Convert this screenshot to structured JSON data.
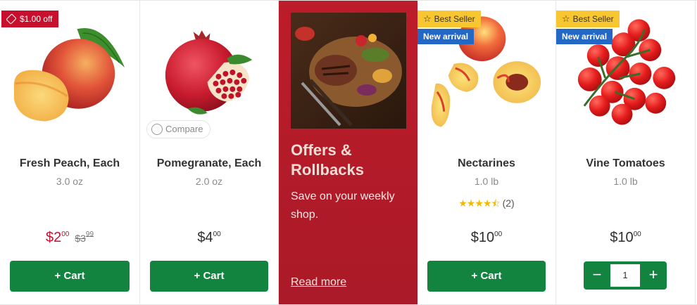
{
  "colors": {
    "cart_green": "#12843f",
    "sale_red": "#c8102e",
    "promo_red": "#b51c29",
    "best_seller_yellow": "#f7c630",
    "new_arrival_blue": "#2468c6"
  },
  "products": [
    {
      "name": "Fresh Peach, Each",
      "size": "3.0 oz",
      "badge_off": "$1.00 off",
      "price_dollars": "$2",
      "price_cents": "00",
      "was_dollars": "$3",
      "was_cents": "99",
      "cart_label": "+ Cart",
      "image_icon": "peach-image"
    },
    {
      "name": "Pomegranate, Each",
      "size": "2.0 oz",
      "compare_label": "Compare",
      "price_dollars": "$4",
      "price_cents": "00",
      "cart_label": "+ Cart",
      "image_icon": "pomegranate-image"
    },
    {
      "name": "Nectarines",
      "size": "1.0 lb",
      "badge_best": "Best Seller",
      "badge_new": "New arrival",
      "rating_stars": 4.5,
      "rating_count": "(2)",
      "price_dollars": "$10",
      "price_cents": "00",
      "cart_label": "+ Cart",
      "image_icon": "nectarine-image"
    },
    {
      "name": "Vine Tomatoes",
      "size": "1.0 lb",
      "badge_best": "Best Seller",
      "badge_new": "New arrival",
      "price_dollars": "$10",
      "price_cents": "00",
      "quantity": "1",
      "minus_label": "−",
      "plus_label": "+",
      "image_icon": "tomatoes-image"
    }
  ],
  "promo": {
    "title": "Offers & Rollbacks",
    "text": "Save on your weekly shop.",
    "link": "Read more",
    "image_icon": "grilled-steak-image"
  }
}
